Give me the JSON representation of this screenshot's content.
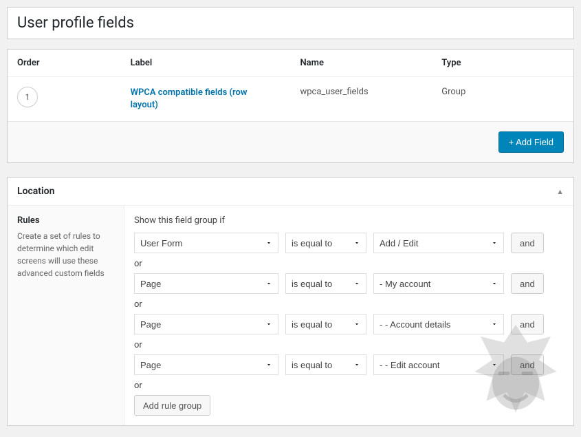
{
  "header": {
    "title": "User profile fields"
  },
  "table": {
    "columns": {
      "order": "Order",
      "label": "Label",
      "name": "Name",
      "type": "Type"
    },
    "rows": [
      {
        "order": "1",
        "label": "WPCA compatible fields (row layout)",
        "name": "wpca_user_fields",
        "type": "Group"
      }
    ],
    "add_button": "+ Add Field"
  },
  "location": {
    "heading": "Location",
    "sidebar_title": "Rules",
    "sidebar_desc": "Create a set of rules to determine which edit screens will use these advanced custom fields",
    "intro": "Show this field group if",
    "rules": [
      {
        "param": "User Form",
        "op": "is equal to",
        "value": "Add / Edit",
        "and": "and"
      },
      {
        "param": "Page",
        "op": "is equal to",
        "value": "- My account",
        "and": "and"
      },
      {
        "param": "Page",
        "op": "is equal to",
        "value": "- - Account details",
        "and": "and"
      },
      {
        "param": "Page",
        "op": "is equal to",
        "value": "- - Edit account",
        "and": "and"
      }
    ],
    "or_text": "or",
    "add_group": "Add rule group"
  }
}
